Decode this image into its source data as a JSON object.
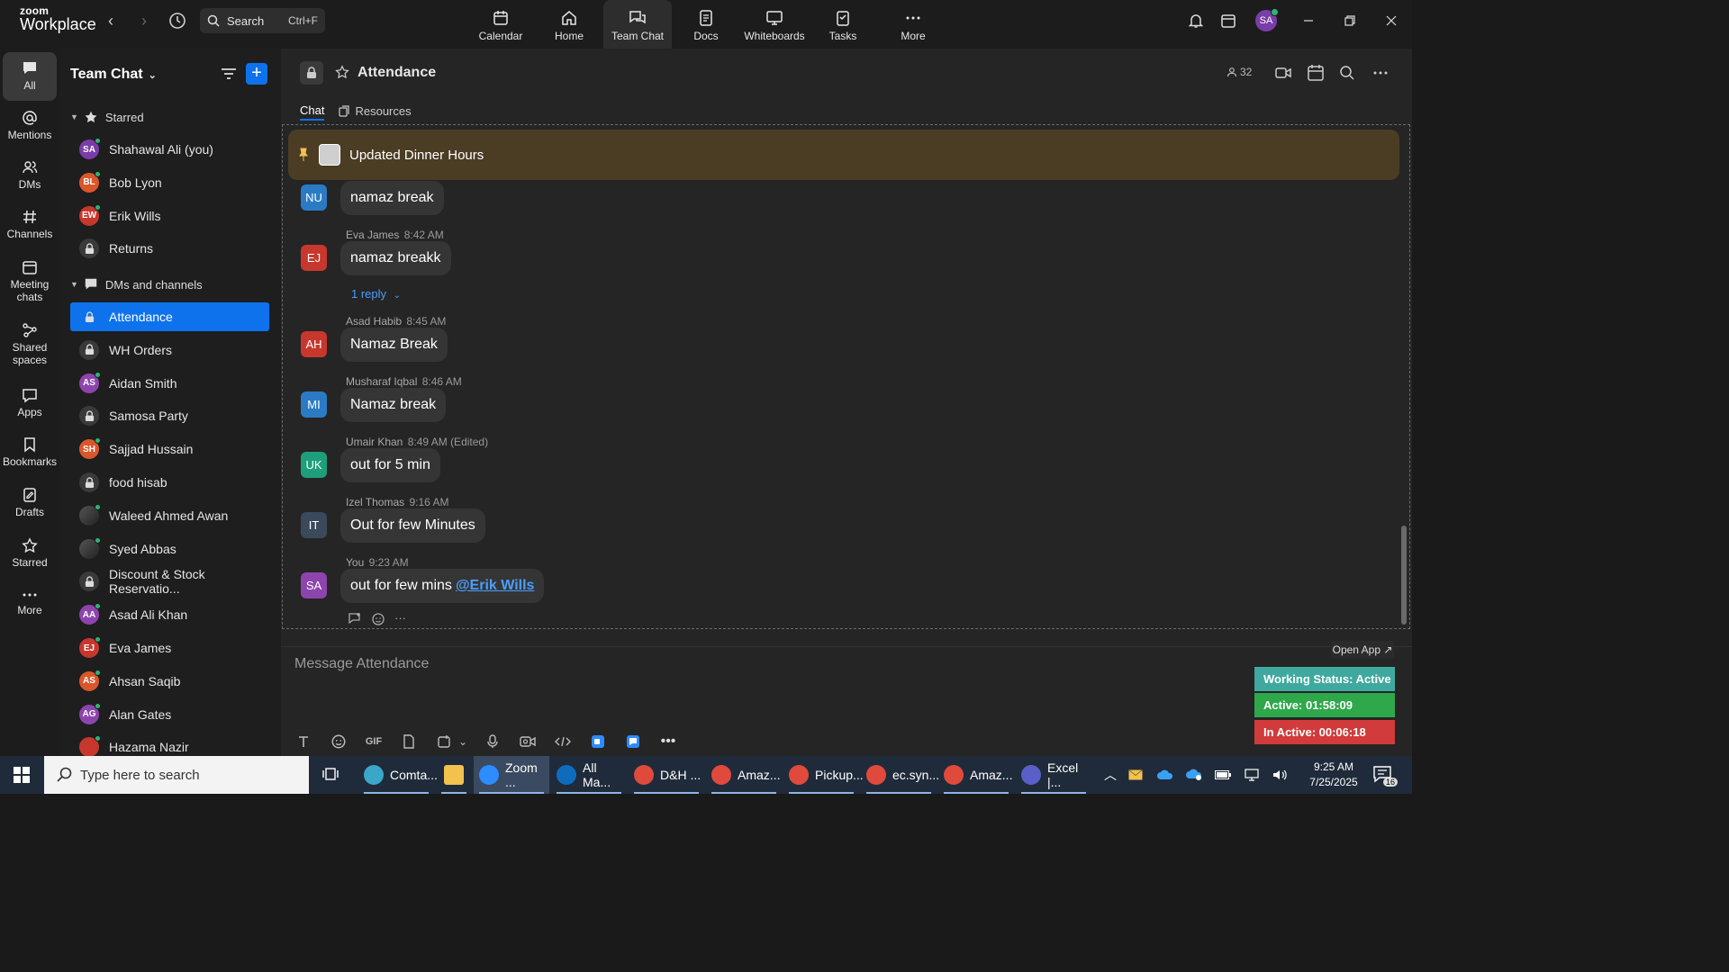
{
  "app": {
    "logo_top": "zoom",
    "logo_bottom": "Workplace"
  },
  "search": {
    "label": "Search",
    "shortcut": "Ctrl+F"
  },
  "topnav": [
    {
      "label": "Calendar",
      "icon": "calendar-icon"
    },
    {
      "label": "Home",
      "icon": "home-icon"
    },
    {
      "label": "Team Chat",
      "icon": "chat-icon",
      "active": true
    },
    {
      "label": "Docs",
      "icon": "docs-icon"
    },
    {
      "label": "Whiteboards",
      "icon": "whiteboard-icon"
    },
    {
      "label": "Tasks",
      "icon": "tasks-icon"
    },
    {
      "label": "More",
      "icon": "more-icon"
    }
  ],
  "user": {
    "initials": "SA"
  },
  "rail": [
    {
      "label": "All",
      "icon": "chat-bubble-icon",
      "active": true
    },
    {
      "label": "Mentions",
      "icon": "at-icon"
    },
    {
      "label": "DMs",
      "icon": "people-icon"
    },
    {
      "label": "Channels",
      "icon": "hash-icon"
    },
    {
      "label": "Meeting chats",
      "icon": "meeting-icon"
    },
    {
      "label": "Shared spaces",
      "icon": "shared-icon"
    },
    {
      "label": "Apps",
      "icon": "apps-icon"
    },
    {
      "label": "Bookmarks",
      "icon": "bookmark-icon"
    },
    {
      "label": "Drafts",
      "icon": "drafts-icon"
    },
    {
      "label": "Starred",
      "icon": "star-icon"
    },
    {
      "label": "More",
      "icon": "more-icon"
    }
  ],
  "sidebar": {
    "title": "Team Chat",
    "starred_label": "Starred",
    "dms_label": "DMs and channels",
    "starred": [
      {
        "name": "Shahawal Ali (you)",
        "initials": "SA",
        "color": "#7a3da8",
        "type": "user"
      },
      {
        "name": "Bob Lyon",
        "initials": "BL",
        "color": "#d9572b",
        "type": "user"
      },
      {
        "name": "Erik Wills",
        "initials": "EW",
        "color": "#c8372d",
        "type": "user"
      },
      {
        "name": "Returns",
        "type": "channel"
      }
    ],
    "channels": [
      {
        "name": "Attendance",
        "type": "channel",
        "active": true
      },
      {
        "name": "WH Orders",
        "type": "channel"
      },
      {
        "name": "Aidan Smith",
        "initials": "AS",
        "color": "#8e44ad",
        "type": "user"
      },
      {
        "name": "Samosa Party",
        "type": "channel"
      },
      {
        "name": "Sajjad Hussain",
        "initials": "SH",
        "color": "#d9572b",
        "type": "user"
      },
      {
        "name": "food hisab",
        "type": "channel"
      },
      {
        "name": "Waleed Ahmed Awan",
        "type": "photo"
      },
      {
        "name": "Syed Abbas",
        "type": "photo"
      },
      {
        "name": "Discount & Stock Reservatio...",
        "type": "channel"
      },
      {
        "name": "Asad Ali Khan",
        "initials": "AA",
        "color": "#8e44ad",
        "type": "user"
      },
      {
        "name": "Eva James",
        "initials": "EJ",
        "color": "#c8372d",
        "type": "user"
      },
      {
        "name": "Ahsan Saqib",
        "initials": "AS",
        "color": "#d9572b",
        "type": "user"
      },
      {
        "name": "Alan Gates",
        "initials": "AG",
        "color": "#8e44ad",
        "type": "user"
      },
      {
        "name": "Hazama Nazir",
        "initials": "",
        "color": "#c8372d",
        "type": "user"
      }
    ]
  },
  "channel": {
    "name": "Attendance",
    "members": "32",
    "tabs": [
      "Chat",
      "Resources"
    ],
    "pinned": "Updated Dinner Hours",
    "reply_label": "1 reply",
    "composer_placeholder": "Message Attendance",
    "open_app": "Open App ↗"
  },
  "messages": [
    {
      "initials": "NU",
      "color": "#2b7bc4",
      "author": "",
      "time": "",
      "text": "namaz break"
    },
    {
      "initials": "EJ",
      "color": "#c8372d",
      "author": "Eva James",
      "time": "8:42 AM",
      "text": "namaz breakk"
    },
    {
      "initials": "AH",
      "color": "#c8372d",
      "author": "Asad Habib",
      "time": "8:45 AM",
      "text": "Namaz Break"
    },
    {
      "initials": "MI",
      "color": "#2b7bc4",
      "author": "Musharaf Iqbal",
      "time": "8:46 AM",
      "text": "Namaz break"
    },
    {
      "initials": "UK",
      "color": "#1e9e7a",
      "author": "Umair Khan",
      "time": "8:49 AM (Edited)",
      "text": "out for 5 min"
    },
    {
      "initials": "IT",
      "color": "#3a4a5c",
      "author": "Izel Thomas",
      "time": "9:16 AM",
      "text": "Out for few Minutes"
    },
    {
      "initials": "SA",
      "color": "#8e44ad",
      "author": "You",
      "time": "9:23 AM",
      "text": "out for few mins",
      "mention": "@Erik Wills"
    }
  ],
  "status_widget": {
    "working": "Working Status: Active",
    "active": "Active: 01:58:09",
    "inactive": "In Active: 00:06:18",
    "colors": {
      "working": "#3fa9a0",
      "active": "#2ea84a",
      "inactive": "#d23b3b"
    }
  },
  "taskbar": {
    "search_placeholder": "Type here to search",
    "apps": [
      {
        "label": "Comta...",
        "color": "#3aa7c9"
      },
      {
        "label": "",
        "color": "#f2c14e",
        "icon": "folder-icon"
      },
      {
        "label": "Zoom ...",
        "color": "#2d8cff",
        "active": true
      },
      {
        "label": "All Ma...",
        "color": "#0f6cbd"
      },
      {
        "label": "D&H ...",
        "color": "#e04a3c"
      },
      {
        "label": "Amaz...",
        "color": "#e04a3c"
      },
      {
        "label": "Pickup...",
        "color": "#e04a3c"
      },
      {
        "label": "ec.syn...",
        "color": "#e04a3c"
      },
      {
        "label": "Amaz...",
        "color": "#e04a3c"
      },
      {
        "label": "Excel |...",
        "color": "#5a5fc7"
      }
    ],
    "time": "9:25 AM",
    "date": "7/25/2025",
    "notifications": "16"
  }
}
